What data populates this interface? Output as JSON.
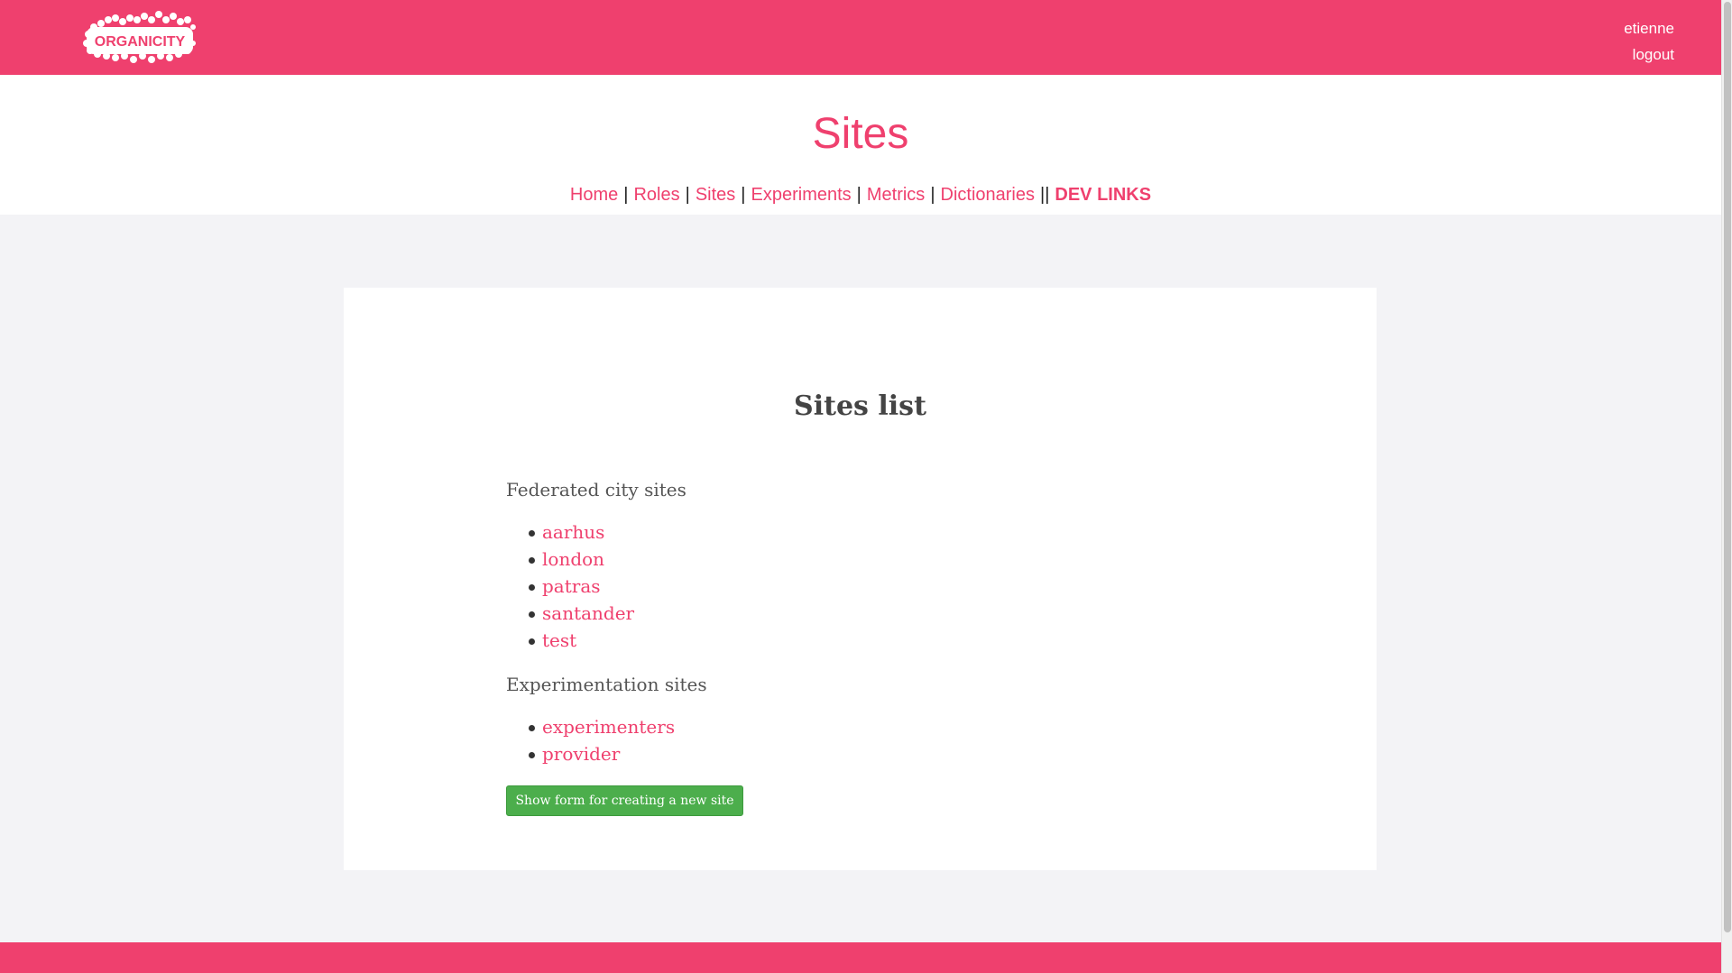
{
  "header": {
    "logo_text": "ORGANICITY",
    "username": "etienne",
    "logout_label": "logout"
  },
  "page": {
    "title": "Sites"
  },
  "nav": {
    "home": "Home",
    "roles": "Roles",
    "sites": "Sites",
    "experiments": "Experiments",
    "metrics": "Metrics",
    "dictionaries": "Dictionaries",
    "dev_links": "DEV LINKS",
    "sep_single": "|",
    "sep_double": "||"
  },
  "content": {
    "heading": "Sites list",
    "federated_heading": "Federated city sites",
    "federated_sites": [
      "aarhus",
      "london",
      "patras",
      "santander",
      "test"
    ],
    "experimentation_heading": "Experimentation sites",
    "experimentation_sites": [
      "experimenters",
      "provider"
    ],
    "create_button_label": "Show form for creating a new site"
  },
  "colors": {
    "brand": "#ef406e",
    "button_green": "#4cae4c",
    "background": "#f3f3f6"
  }
}
